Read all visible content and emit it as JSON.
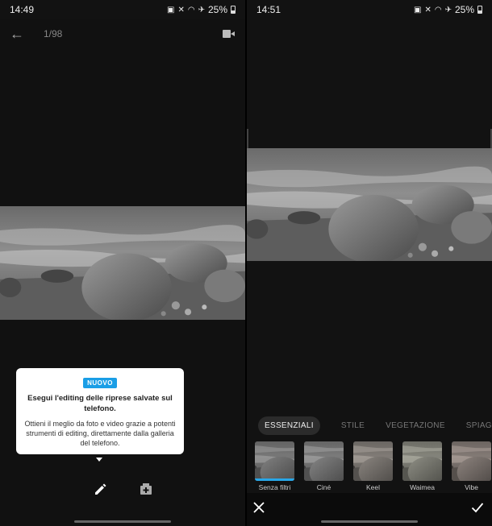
{
  "left": {
    "status": {
      "time": "14:49",
      "battery": "25%"
    },
    "counter": "1/98",
    "tooltip": {
      "badge": "NUOVO",
      "title": "Esegui l'editing delle riprese salvate sul telefono.",
      "body": "Ottieni il meglio da foto e video grazie a potenti strumenti di editing, direttamente dalla galleria del telefono."
    }
  },
  "right": {
    "status": {
      "time": "14:51",
      "battery": "25%"
    },
    "tabs": [
      {
        "label": "ESSENZIALI",
        "active": true
      },
      {
        "label": "STILE",
        "active": false
      },
      {
        "label": "VEGETAZIONE",
        "active": false
      },
      {
        "label": "SPIAGGI",
        "active": false
      }
    ],
    "filters": [
      {
        "label": "Senza filtri",
        "tint": "#888888",
        "selected": true
      },
      {
        "label": "Ciné",
        "tint": "#9a9a9a",
        "selected": false
      },
      {
        "label": "Keel",
        "tint": "#b89e82",
        "selected": false
      },
      {
        "label": "Waimea",
        "tint": "#c9c79a",
        "selected": false
      },
      {
        "label": "Vibe",
        "tint": "#c2937a",
        "selected": false
      }
    ]
  },
  "colors": {
    "accent": "#1a9ee6",
    "selection": "#28a7e8"
  },
  "icons": [
    "back-arrow-icon",
    "camera-import-icon",
    "pencil-icon",
    "add-media-icon",
    "close-icon",
    "check-icon"
  ]
}
